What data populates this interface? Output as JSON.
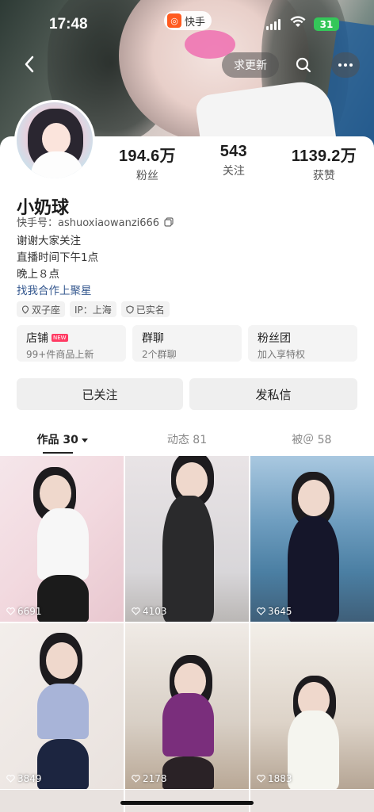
{
  "status_bar": {
    "time": "17:48",
    "app_name": "快手",
    "battery": "31"
  },
  "top_nav": {
    "update_button": "求更新"
  },
  "profile": {
    "name": "小奶球",
    "handle_label": "快手号：ashuoxiaowanzi666",
    "bio_lines": [
      "谢谢大家关注",
      "直播时间下午1点",
      "晚上８点"
    ],
    "bio_link": "找我合作上聚星",
    "tags": [
      "双子座",
      "IP：上海",
      "已实名"
    ]
  },
  "stats": [
    {
      "value": "194.6万",
      "label": "粉丝"
    },
    {
      "value": "543",
      "label": "关注"
    },
    {
      "value": "1139.2万",
      "label": "获赞"
    }
  ],
  "features": [
    {
      "title": "店铺",
      "badge": "NEW",
      "subtitle": "99+件商品上新"
    },
    {
      "title": "群聊",
      "subtitle": "2个群聊"
    },
    {
      "title": "粉丝团",
      "subtitle": "加入享特权"
    }
  ],
  "actions": {
    "followed": "已关注",
    "message": "发私信"
  },
  "tabs": [
    {
      "label": "作品 30"
    },
    {
      "label": "动态 81"
    },
    {
      "label": "被＠ 58"
    }
  ],
  "posts": [
    {
      "likes": "6691"
    },
    {
      "likes": "4103"
    },
    {
      "likes": "3645"
    },
    {
      "likes": "3849"
    },
    {
      "likes": "2178"
    },
    {
      "likes": "1883"
    }
  ]
}
